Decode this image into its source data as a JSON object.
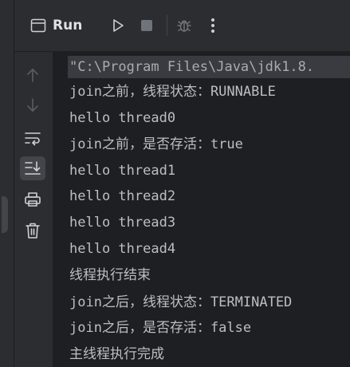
{
  "header": {
    "title": "Run",
    "icons": [
      "window-icon",
      "run-icon",
      "stop-icon",
      "debug-icon",
      "more-icon"
    ]
  },
  "sidebar": {
    "buttons": [
      "up-arrow-icon",
      "down-arrow-icon",
      "soft-wrap-icon",
      "scroll-to-end-icon",
      "print-icon",
      "trash-icon"
    ],
    "active": "scroll-to-end-icon"
  },
  "console": {
    "lines": [
      "\"C:\\Program Files\\Java\\jdk1.8.",
      "join之前，线程状态：RUNNABLE",
      "hello thread0",
      "join之前，是否存活：true",
      "hello thread1",
      "hello thread2",
      "hello thread3",
      "hello thread4",
      "线程执行结束",
      "join之后，线程状态：TERMINATED",
      "join之后，是否存活：false",
      "主线程执行完成"
    ]
  },
  "colors": {
    "background": "#1e1f22",
    "panel": "#2b2d30",
    "text": "#bcbec4",
    "icon": "#ced0d6",
    "disabled_icon": "#6f737a"
  }
}
